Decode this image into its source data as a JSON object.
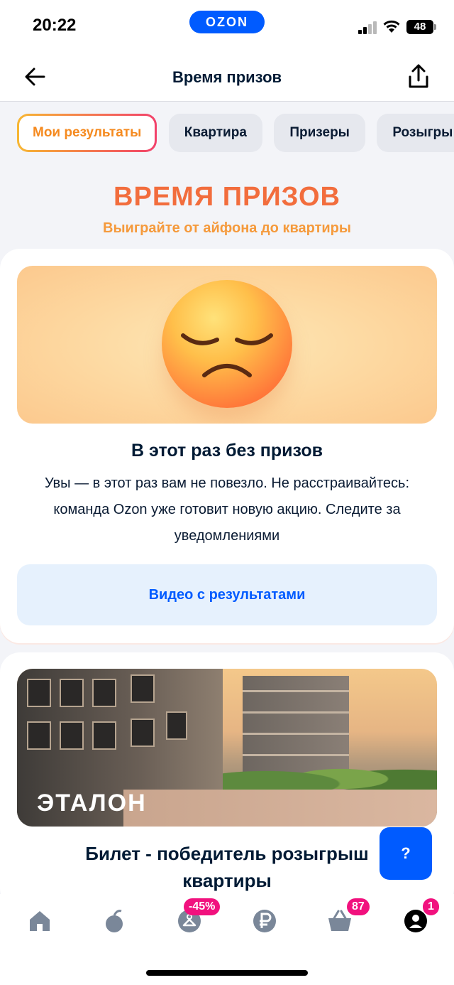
{
  "status_bar": {
    "time": "20:22",
    "brand": "OZON",
    "battery": "48"
  },
  "header": {
    "title": "Время призов"
  },
  "tabs": [
    {
      "label": "Мои результаты"
    },
    {
      "label": "Квартира"
    },
    {
      "label": "Призеры"
    },
    {
      "label": "Розыгры"
    }
  ],
  "hero": {
    "title": "ВРЕМЯ ПРИЗОВ",
    "subtitle": "Выиграйте от айфона до квартиры"
  },
  "result_card": {
    "title": "В этот раз без призов",
    "text": "Увы — в этот раз вам не повезло. Не расстраивайтесь: команда Ozon уже готовит новую акцию. Следите за уведомлениями",
    "button": "Видео с результатами"
  },
  "prize_card": {
    "image_caption": "ЭТАЛОН",
    "title_line1": "Билет - победитель розыгрыш",
    "title_line2": "квартиры"
  },
  "help": {
    "label": "?"
  },
  "tabbar": {
    "items": [
      {
        "icon": "home-icon",
        "badge": ""
      },
      {
        "icon": "fresh-icon",
        "badge": ""
      },
      {
        "icon": "fashion-icon",
        "badge": "-45%"
      },
      {
        "icon": "finance-icon",
        "badge": ""
      },
      {
        "icon": "cart-icon",
        "badge": "87"
      },
      {
        "icon": "profile-icon",
        "badge": "1"
      }
    ]
  },
  "colors": {
    "brand_blue": "#005bff",
    "accent_orange": "#f26d3d",
    "badge_pink": "#f1117e"
  }
}
